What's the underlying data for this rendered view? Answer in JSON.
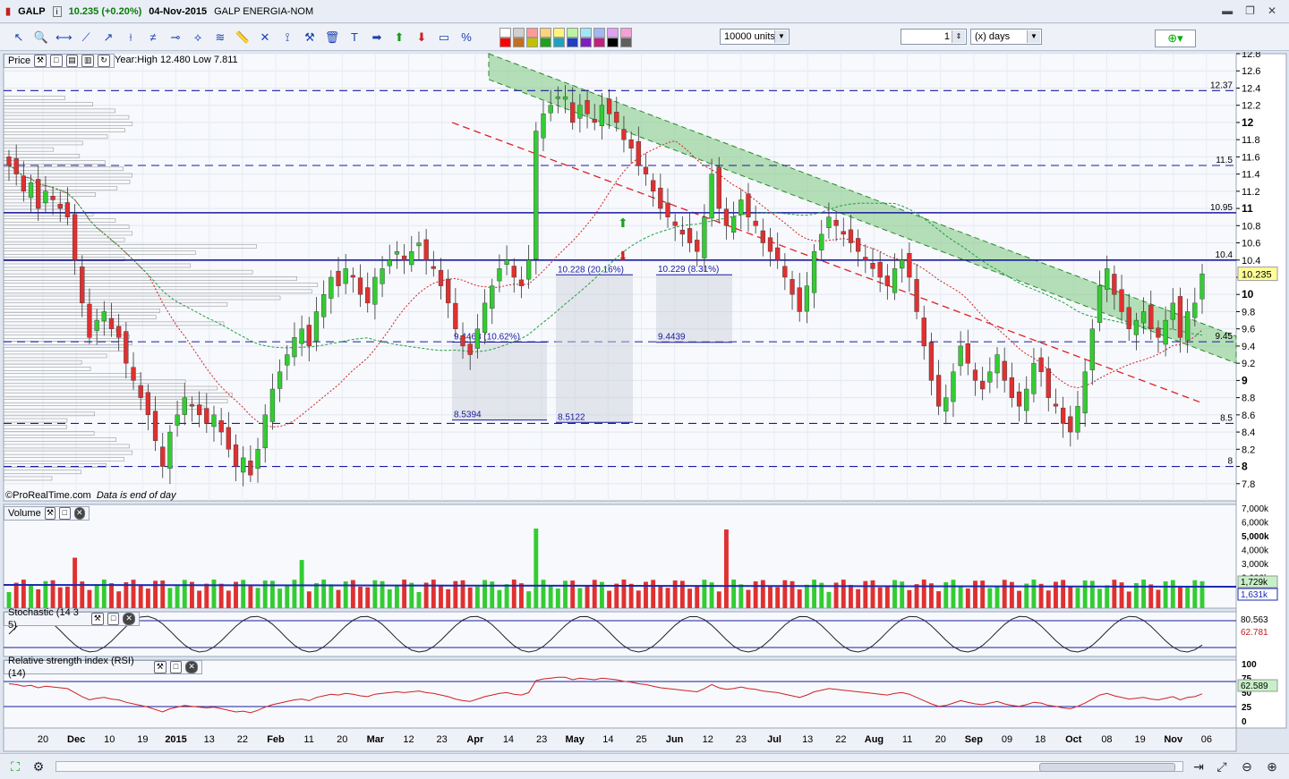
{
  "titlebar": {
    "symbol": "GALP",
    "price": "10.235 (+0.20%)",
    "date": "04-Nov-2015",
    "name": "GALP ENERGIA-NOM"
  },
  "toolbar": {
    "units_value": "10000 units",
    "period_value": "1",
    "period_unit": "(x) days",
    "tools": [
      "cursor-icon",
      "zoom-icon",
      "line-icon",
      "trend-icon",
      "ray-icon",
      "vertical-line-icon",
      "channel-icon",
      "horizontal-line-icon",
      "fan-icon",
      "fibonacci-icon",
      "ruler-icon",
      "cross-icon",
      "magnet-icon",
      "hammer-icon",
      "trash-icon",
      "text-icon",
      "arrow-right-icon",
      "arrow-up-icon",
      "arrow-down-icon",
      "rectangle-icon",
      "percent-icon"
    ],
    "swatch_colors": [
      "#ffffff",
      "#d0d0d0",
      "#ff9a9a",
      "#ffd27a",
      "#fff37a",
      "#b9f5a0",
      "#a0e8f5",
      "#a0b8f5",
      "#e0a0f5",
      "#f5a0d8",
      "#ff0000",
      "#c07020",
      "#c0c000",
      "#20a020",
      "#20a0c0",
      "#2040c0",
      "#8020c0",
      "#c02080",
      "#000000",
      "#606060"
    ]
  },
  "price_panel": {
    "label": "Price",
    "year_info": "Year:High 12.480 Low 7.811",
    "credit": "©ProRealTime.com",
    "credit_note": "Data is end of day",
    "last_price": "10.235"
  },
  "volume_panel": {
    "label": "Volume",
    "tag1": "1,729k",
    "tag2": "1,631k"
  },
  "stoch_panel": {
    "label": "Stochastic (14 3 5)",
    "tag1": "80.563",
    "tag2": "62.781"
  },
  "rsi_panel": {
    "label": "Relative strength index (RSI) (14)",
    "tag1": "62.589"
  },
  "chart_data": {
    "type": "candlestick",
    "title": "GALP ENERGIA-NOM",
    "price_axis": {
      "min": 7.6,
      "max": 12.8,
      "ticks": [
        "7.8",
        "8",
        "8.2",
        "8.4",
        "8.6",
        "8.8",
        "9",
        "9.2",
        "9.4",
        "9.6",
        "9.8",
        "10",
        "10.2",
        "10.4",
        "10.6",
        "10.8",
        "11",
        "11.2",
        "11.4",
        "11.6",
        "11.8",
        "12",
        "12.2",
        "12.4",
        "12.6",
        "12.8"
      ]
    },
    "x_axis_labels": [
      "20",
      "Dec",
      "10",
      "19",
      "2015",
      "13",
      "22",
      "Feb",
      "11",
      "20",
      "Mar",
      "12",
      "23",
      "Apr",
      "14",
      "23",
      "May",
      "14",
      "25",
      "Jun",
      "12",
      "23",
      "Jul",
      "13",
      "22",
      "Aug",
      "11",
      "20",
      "Sep",
      "09",
      "18",
      "Oct",
      "08",
      "19",
      "Nov",
      "06"
    ],
    "horizontal_levels": [
      {
        "value": 12.37,
        "label": "12.37",
        "style": "dashed"
      },
      {
        "value": 11.5,
        "label": "11.5",
        "style": "dashed"
      },
      {
        "value": 10.95,
        "label": "10.95",
        "style": "solid"
      },
      {
        "value": 10.4,
        "label": "10.4",
        "style": "solid"
      },
      {
        "value": 9.45,
        "label": "9.45",
        "style": "dashed"
      },
      {
        "value": 8.5,
        "label": "8.5",
        "style": "dashed"
      },
      {
        "value": 8.0,
        "label": "8",
        "style": "dashed"
      }
    ],
    "measurement_boxes": [
      {
        "top_label": "9.4463 (10.62%)",
        "top": 9.4463,
        "bottom_label": "8.5394",
        "bottom": 8.5394
      },
      {
        "top_label": "10.228 (20.16%)",
        "top": 10.228,
        "bottom_label": "8.5122",
        "bottom": 8.5122
      },
      {
        "top_label": "10.229 (8.31%)",
        "top": 10.229,
        "bottom_label": "9.4439",
        "bottom": 9.4439
      }
    ],
    "closes": [
      11.5,
      11.4,
      11.2,
      11.3,
      11.0,
      11.2,
      11.1,
      11.0,
      10.9,
      10.4,
      9.9,
      9.5,
      9.7,
      9.8,
      9.6,
      9.5,
      9.2,
      9.0,
      8.8,
      8.6,
      8.3,
      8.0,
      8.4,
      8.6,
      8.8,
      8.7,
      8.6,
      8.5,
      8.6,
      8.4,
      8.2,
      8.0,
      8.1,
      7.9,
      8.2,
      8.6,
      8.9,
      9.1,
      9.3,
      9.5,
      9.6,
      9.4,
      9.8,
      10.0,
      10.2,
      10.1,
      10.3,
      10.2,
      10.0,
      9.9,
      10.2,
      10.3,
      10.4,
      10.5,
      10.4,
      10.5,
      10.6,
      10.4,
      10.3,
      10.1,
      9.9,
      9.6,
      9.4,
      9.3,
      9.6,
      9.9,
      10.1,
      10.3,
      10.4,
      10.2,
      10.1,
      10.4,
      11.9,
      12.1,
      12.2,
      12.3,
      12.3,
      12.0,
      12.2,
      12.1,
      12.0,
      12.2,
      12.1,
      12.0,
      11.8,
      11.7,
      11.5,
      11.4,
      11.2,
      11.0,
      10.9,
      10.8,
      10.7,
      10.6,
      10.5,
      10.9,
      11.4,
      11.0,
      10.8,
      10.9,
      11.1,
      10.9,
      10.8,
      10.6,
      10.5,
      10.4,
      10.2,
      10.0,
      9.8,
      10.1,
      10.5,
      10.7,
      10.9,
      10.8,
      10.7,
      10.6,
      10.5,
      10.4,
      10.3,
      10.2,
      10.1,
      10.3,
      10.4,
      10.2,
      9.8,
      9.4,
      9.0,
      8.7,
      8.8,
      9.1,
      9.4,
      9.2,
      9.0,
      8.9,
      9.1,
      9.3,
      9.0,
      8.8,
      8.7,
      8.9,
      9.2,
      9.1,
      8.8,
      8.7,
      8.5,
      8.4,
      8.7,
      9.1,
      9.6,
      10.1,
      10.3,
      10.0,
      9.8,
      9.6,
      9.7,
      9.8,
      9.6,
      9.5,
      9.7,
      9.9,
      9.5,
      9.8,
      9.9,
      10.24
    ]
  },
  "axis_labels_volume": [
    "7,000k",
    "6,000k",
    "5,000k",
    "4,000k",
    "3,000k",
    "2,000k"
  ],
  "axis_labels_stoch": [],
  "axis_labels_rsi": [
    "100",
    "75",
    "50",
    "25",
    "0"
  ]
}
